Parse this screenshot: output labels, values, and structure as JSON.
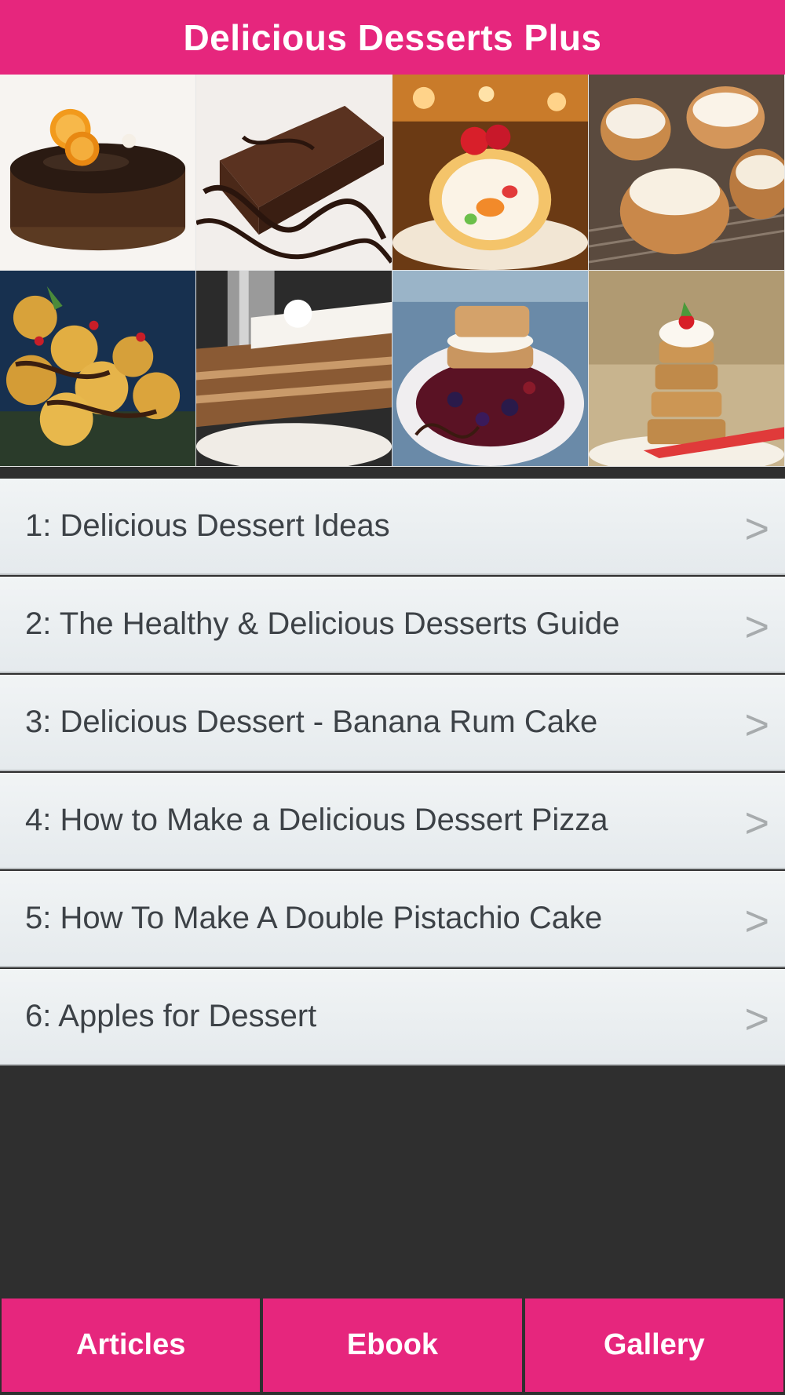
{
  "header": {
    "title": "Delicious Desserts Plus"
  },
  "colors": {
    "accent": "#e6267d",
    "background": "#2f2f2f",
    "list_text": "#3d4247"
  },
  "gallery": {
    "images": [
      {
        "name": "chocolate-orange-cake"
      },
      {
        "name": "chocolate-brownie"
      },
      {
        "name": "strawberry-roll-cake"
      },
      {
        "name": "cream-puffs"
      },
      {
        "name": "profiteroles-chocolate"
      },
      {
        "name": "layered-cake-slice"
      },
      {
        "name": "berry-waffle-dessert"
      },
      {
        "name": "waffle-tower"
      }
    ]
  },
  "list": {
    "items": [
      {
        "label": "1: Delicious Dessert Ideas",
        "chevron": ">"
      },
      {
        "label": "2: The Healthy & Delicious Desserts Guide",
        "chevron": ">"
      },
      {
        "label": "3: Delicious Dessert - Banana Rum Cake",
        "chevron": ">"
      },
      {
        "label": "4: How to Make a Delicious Dessert Pizza",
        "chevron": ">"
      },
      {
        "label": "5: How To Make A Double Pistachio Cake",
        "chevron": ">"
      },
      {
        "label": "6: Apples for Dessert",
        "chevron": ">"
      }
    ]
  },
  "tabs": [
    {
      "label": "Articles"
    },
    {
      "label": "Ebook"
    },
    {
      "label": "Gallery"
    }
  ]
}
